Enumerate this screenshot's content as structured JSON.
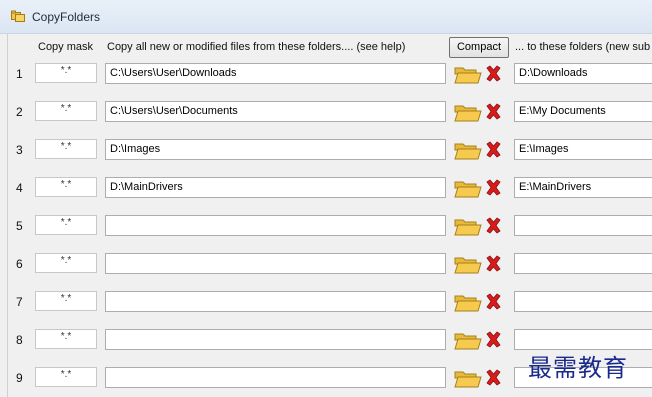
{
  "window": {
    "title": "CopyFolders"
  },
  "header": {
    "mask_label": "Copy mask",
    "source_label": "Copy all new or modified files from these folders.... (see help)",
    "compact_label": "Compact",
    "dest_label": "... to these folders (new sub"
  },
  "rows": [
    {
      "num": "1",
      "mask": "*.*",
      "source": "C:\\Users\\User\\Downloads",
      "dest": "D:\\Downloads"
    },
    {
      "num": "2",
      "mask": "*.*",
      "source": "C:\\Users\\User\\Documents",
      "dest": "E:\\My Documents"
    },
    {
      "num": "3",
      "mask": "*.*",
      "source": "D:\\Images",
      "dest": "E:\\Images"
    },
    {
      "num": "4",
      "mask": "*.*",
      "source": "D:\\MainDrivers",
      "dest": "E:\\MainDrivers"
    },
    {
      "num": "5",
      "mask": "*.*",
      "source": "",
      "dest": ""
    },
    {
      "num": "6",
      "mask": "*.*",
      "source": "",
      "dest": ""
    },
    {
      "num": "7",
      "mask": "*.*",
      "source": "",
      "dest": ""
    },
    {
      "num": "8",
      "mask": "*.*",
      "source": "",
      "dest": ""
    },
    {
      "num": "9",
      "mask": "*.*",
      "source": "",
      "dest": ""
    }
  ],
  "watermark": "最需教育",
  "colors": {
    "accent_red": "#d81c1c",
    "folder_yellow": "#f6c94f",
    "titlebar": "#dbe6f3"
  },
  "icons": {
    "title": "folders-icon",
    "browse": "folder-open-icon",
    "delete": "red-x-icon"
  }
}
